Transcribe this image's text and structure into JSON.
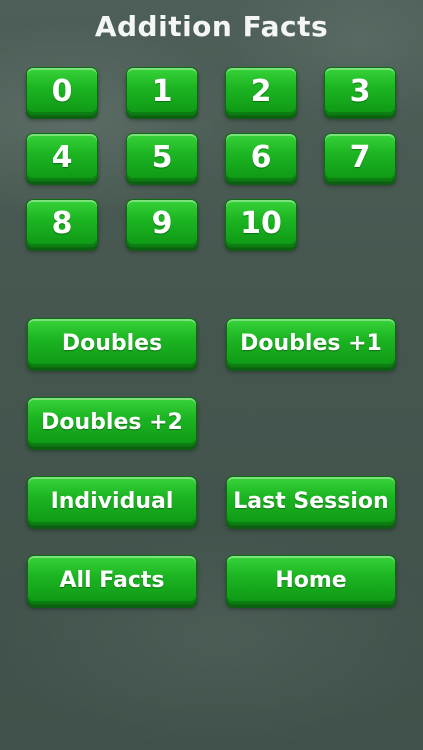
{
  "title": "Addition Facts",
  "number_buttons": [
    "0",
    "1",
    "2",
    "3",
    "4",
    "5",
    "6",
    "7",
    "8",
    "9",
    "10"
  ],
  "buttons": {
    "doubles": "Doubles",
    "doubles_plus_1": "Doubles +1",
    "doubles_plus_2": "Doubles +2",
    "individual": "Individual",
    "last_session": "Last Session",
    "all_facts": "All Facts",
    "home": "Home"
  },
  "colors": {
    "button_green": "#1cb522",
    "chalkboard": "#45574f",
    "text": "#ffffff"
  }
}
